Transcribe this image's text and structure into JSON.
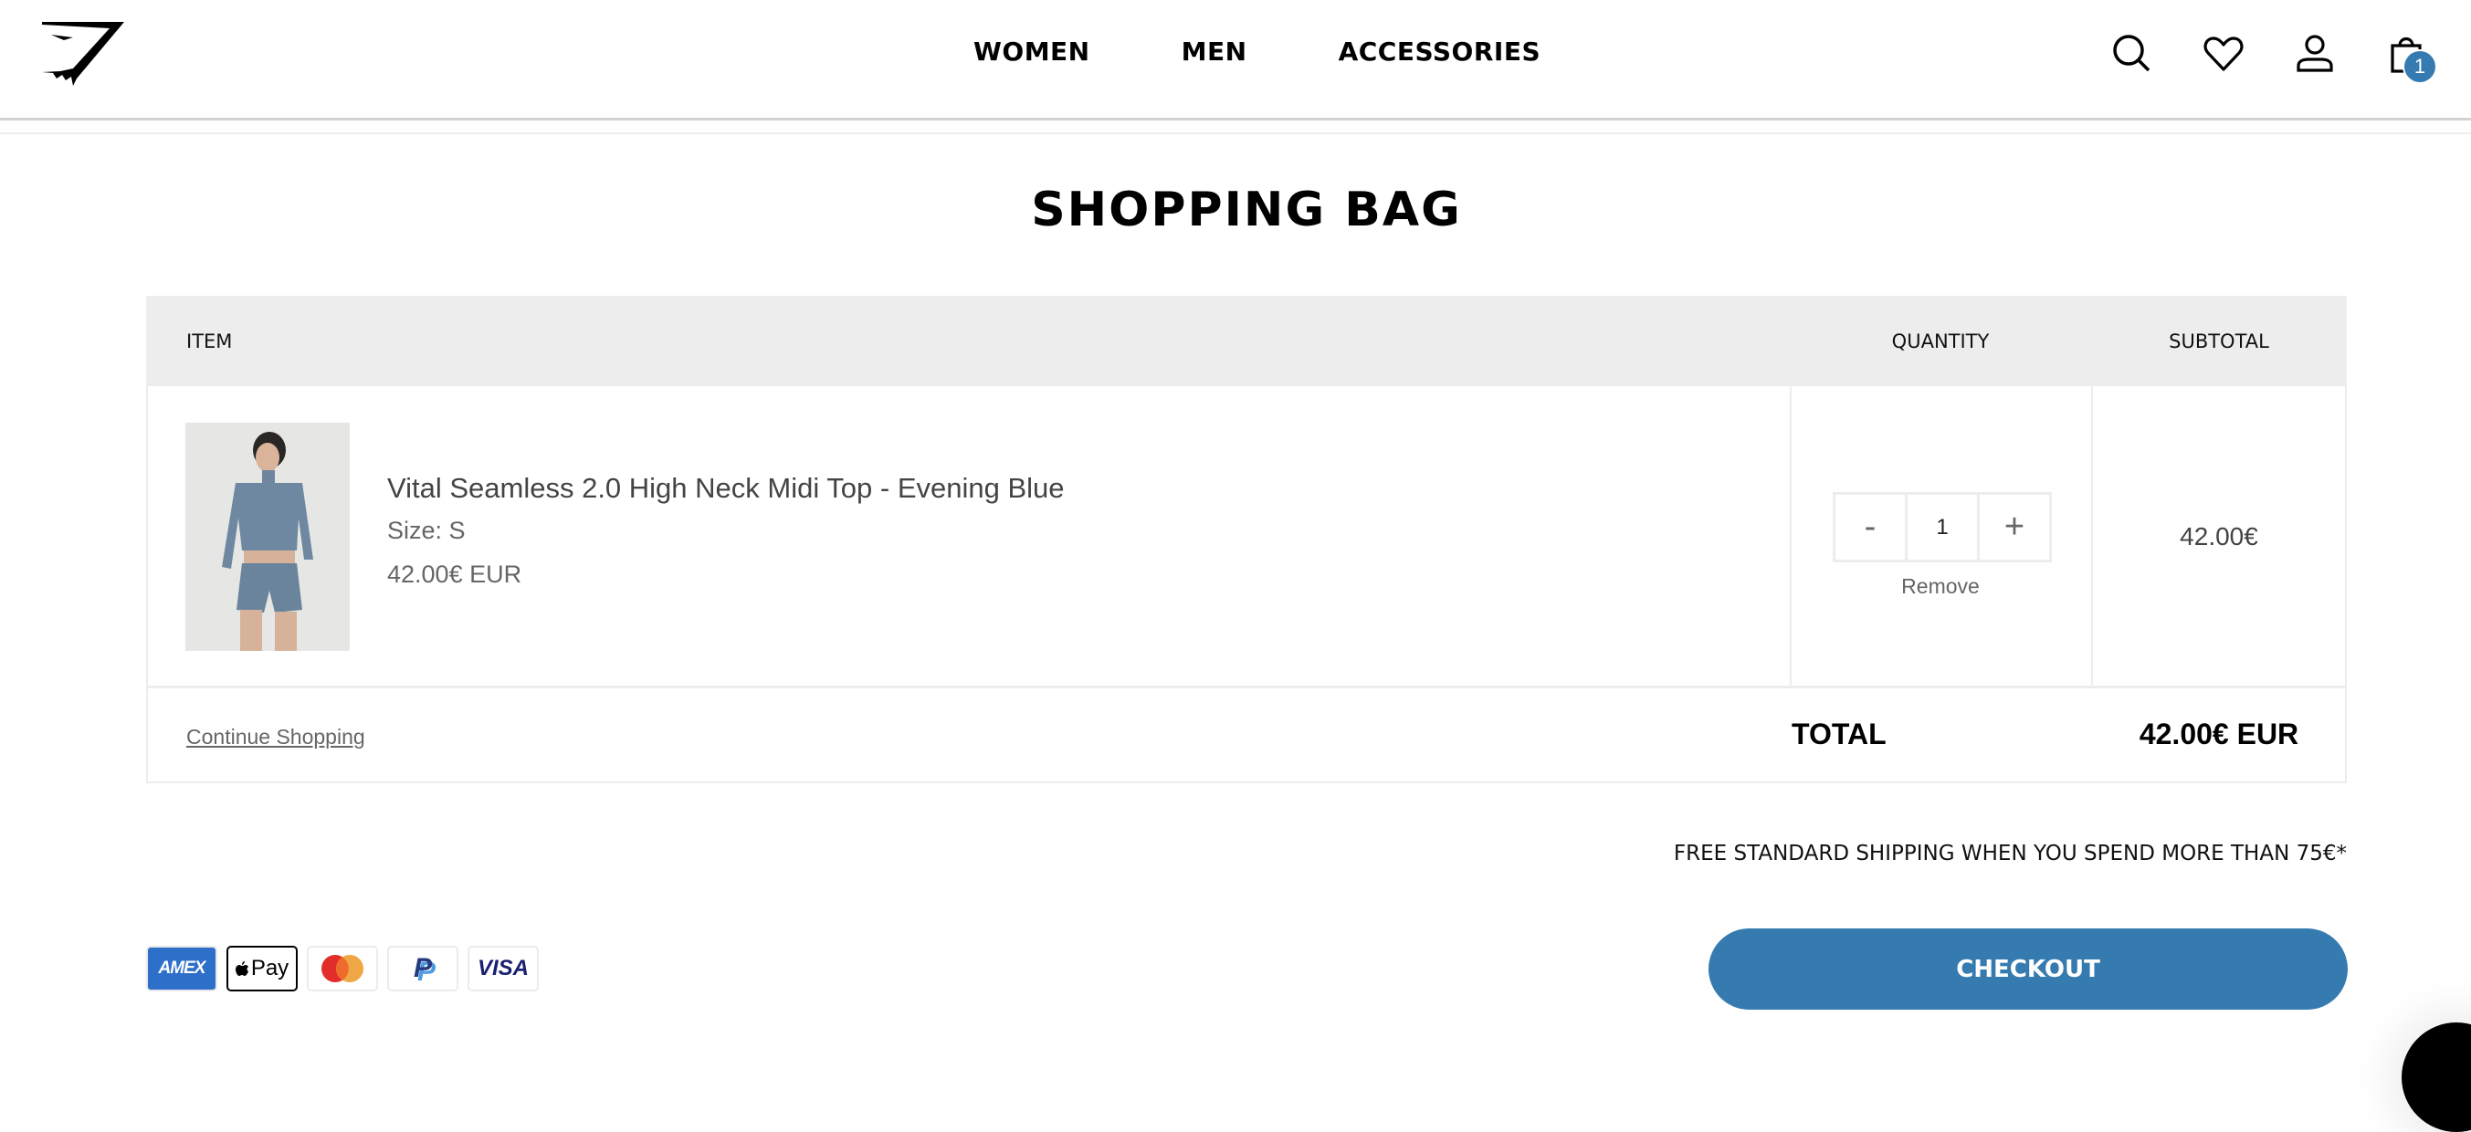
{
  "header": {
    "logo": "gymshark-logo",
    "nav": [
      {
        "label": "WOMEN"
      },
      {
        "label": "MEN"
      },
      {
        "label": "ACCESSORIES"
      }
    ],
    "icons": [
      "search-icon",
      "heart-icon",
      "account-icon",
      "bag-icon"
    ],
    "bag_count": "1"
  },
  "page": {
    "title": "SHOPPING BAG"
  },
  "table": {
    "columns": {
      "item": "ITEM",
      "quantity": "QUANTITY",
      "subtotal": "SUBTOTAL"
    },
    "items": [
      {
        "name": "Vital Seamless 2.0 High Neck Midi Top - Evening Blue",
        "size": "Size: S",
        "price": "42.00€ EUR",
        "quantity": "1",
        "decrement": "-",
        "increment": "+",
        "remove": "Remove",
        "subtotal": "42.00€"
      }
    ],
    "continue_shopping": "Continue Shopping",
    "total_label": "TOTAL",
    "total_value": "42.00€ EUR"
  },
  "shipping_note": "FREE STANDARD SHIPPING WHEN YOU SPEND MORE THAN 75€*",
  "payment_methods": [
    {
      "name": "AMEX",
      "label": "AMEX",
      "color": "#2e6fca"
    },
    {
      "name": "Apple Pay",
      "label": "Pay",
      "color": "#000000"
    },
    {
      "name": "Mastercard",
      "label": "",
      "color": "#e52b2b"
    },
    {
      "name": "PayPal",
      "label": "P",
      "color": "#253b80"
    },
    {
      "name": "Visa",
      "label": "VISA",
      "color": "#1a1f71"
    }
  ],
  "checkout": {
    "label": "CHECKOUT",
    "color": "#367bb0"
  },
  "colors": {
    "accent": "#367bb0",
    "header_bg": "#ededed"
  }
}
